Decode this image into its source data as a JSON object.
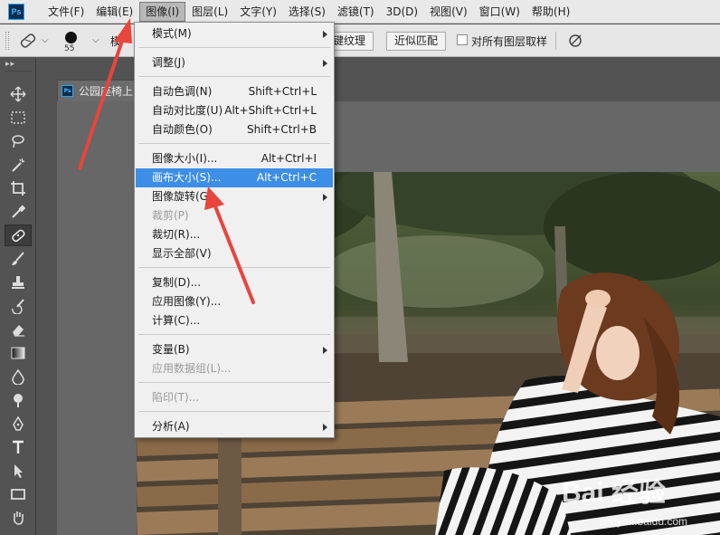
{
  "app": {
    "logo_text": "Ps"
  },
  "menubar": {
    "items": [
      "文件(F)",
      "编辑(E)",
      "图像(I)",
      "图层(L)",
      "文字(Y)",
      "选择(S)",
      "滤镜(T)",
      "3D(D)",
      "视图(V)",
      "窗口(W)",
      "帮助(H)"
    ],
    "active_index": 2
  },
  "options": {
    "brush_size": "55",
    "mode_label": "模",
    "create_texture_label": "键纹理",
    "proximity_match_label": "近似匹配",
    "sample_all_layers_label": "对所有图层取样"
  },
  "document": {
    "tab_icon": "Ps",
    "tab_title": "公园座椅上"
  },
  "image_menu": {
    "items": [
      {
        "label": "模式(M)",
        "shortcut": "",
        "submenu": true,
        "disabled": false,
        "highlight": false
      },
      {
        "label": "调整(J)",
        "shortcut": "",
        "submenu": true,
        "disabled": false,
        "highlight": false
      },
      {
        "label": "自动色调(N)",
        "shortcut": "Shift+Ctrl+L",
        "submenu": false,
        "disabled": false,
        "highlight": false
      },
      {
        "label": "自动对比度(U)",
        "shortcut": "Alt+Shift+Ctrl+L",
        "submenu": false,
        "disabled": false,
        "highlight": false
      },
      {
        "label": "自动颜色(O)",
        "shortcut": "Shift+Ctrl+B",
        "submenu": false,
        "disabled": false,
        "highlight": false
      },
      {
        "label": "图像大小(I)...",
        "shortcut": "Alt+Ctrl+I",
        "submenu": false,
        "disabled": false,
        "highlight": false
      },
      {
        "label": "画布大小(S)...",
        "shortcut": "Alt+Ctrl+C",
        "submenu": false,
        "disabled": false,
        "highlight": true
      },
      {
        "label": "图像旋转(G)",
        "shortcut": "",
        "submenu": true,
        "disabled": false,
        "highlight": false
      },
      {
        "label": "裁剪(P)",
        "shortcut": "",
        "submenu": false,
        "disabled": true,
        "highlight": false
      },
      {
        "label": "裁切(R)...",
        "shortcut": "",
        "submenu": false,
        "disabled": false,
        "highlight": false
      },
      {
        "label": "显示全部(V)",
        "shortcut": "",
        "submenu": false,
        "disabled": false,
        "highlight": false
      },
      {
        "label": "复制(D)...",
        "shortcut": "",
        "submenu": false,
        "disabled": false,
        "highlight": false
      },
      {
        "label": "应用图像(Y)...",
        "shortcut": "",
        "submenu": false,
        "disabled": false,
        "highlight": false
      },
      {
        "label": "计算(C)...",
        "shortcut": "",
        "submenu": false,
        "disabled": false,
        "highlight": false
      },
      {
        "label": "变量(B)",
        "shortcut": "",
        "submenu": true,
        "disabled": false,
        "highlight": false
      },
      {
        "label": "应用数据组(L)...",
        "shortcut": "",
        "submenu": false,
        "disabled": true,
        "highlight": false
      },
      {
        "label": "陷印(T)...",
        "shortcut": "",
        "submenu": false,
        "disabled": true,
        "highlight": false
      },
      {
        "label": "分析(A)",
        "shortcut": "",
        "submenu": true,
        "disabled": false,
        "highlight": false
      }
    ]
  },
  "toolbar": {
    "tools": [
      "move-tool-icon",
      "marquee-tool-icon",
      "lasso-tool-icon",
      "magic-wand-tool-icon",
      "crop-tool-icon",
      "eyedropper-tool-icon",
      "healing-brush-tool-icon",
      "brush-tool-icon",
      "clone-stamp-tool-icon",
      "history-brush-tool-icon",
      "eraser-tool-icon",
      "gradient-tool-icon",
      "blur-tool-icon",
      "dodge-tool-icon",
      "pen-tool-icon",
      "type-tool-icon",
      "path-selection-tool-icon",
      "rectangle-tool-icon",
      "hand-tool-icon"
    ],
    "active_index": 6
  },
  "watermark": {
    "main": "Bai 经验",
    "sub": "jingyan.baidu.com"
  },
  "colors": {
    "highlight": "#3d8ee6",
    "arrow": "#e8453c",
    "menu_bg": "#f0f0f0"
  }
}
